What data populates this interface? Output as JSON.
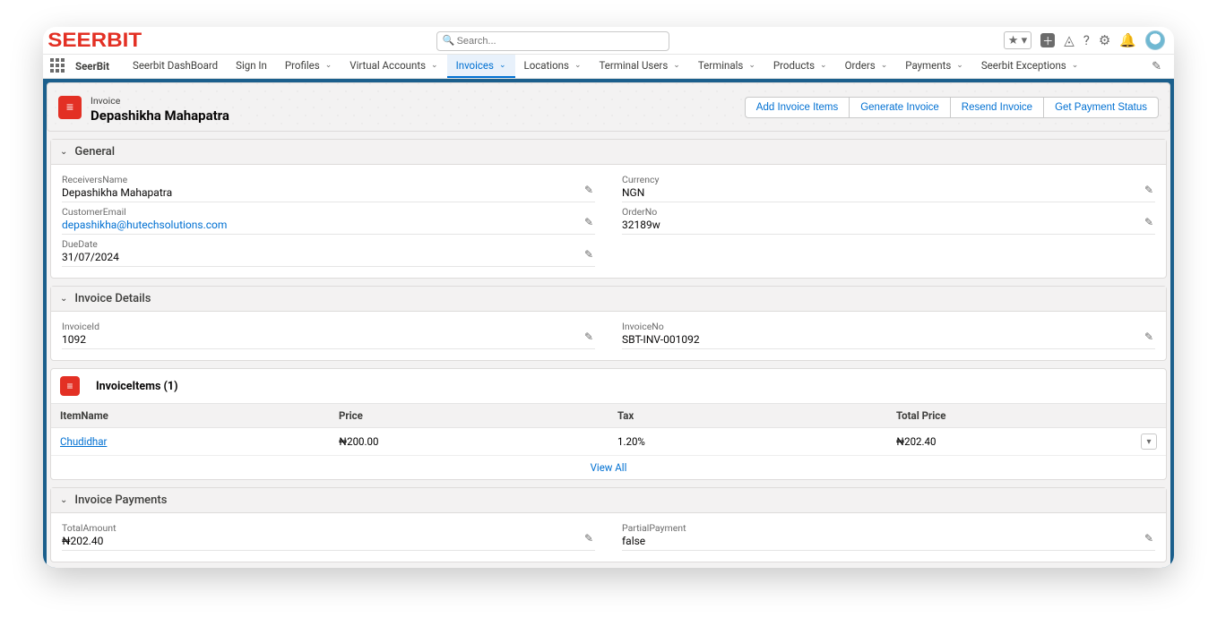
{
  "brand": "SEERBIT",
  "search": {
    "placeholder": "Search..."
  },
  "appName": "SeerBit",
  "nav": [
    {
      "label": "Seerbit DashBoard",
      "hasMenu": false,
      "active": false
    },
    {
      "label": "Sign In",
      "hasMenu": false,
      "active": false
    },
    {
      "label": "Profiles",
      "hasMenu": true,
      "active": false
    },
    {
      "label": "Virtual Accounts",
      "hasMenu": true,
      "active": false
    },
    {
      "label": "Invoices",
      "hasMenu": true,
      "active": true
    },
    {
      "label": "Locations",
      "hasMenu": true,
      "active": false
    },
    {
      "label": "Terminal Users",
      "hasMenu": true,
      "active": false
    },
    {
      "label": "Terminals",
      "hasMenu": true,
      "active": false
    },
    {
      "label": "Products",
      "hasMenu": true,
      "active": false
    },
    {
      "label": "Orders",
      "hasMenu": true,
      "active": false
    },
    {
      "label": "Payments",
      "hasMenu": true,
      "active": false
    },
    {
      "label": "Seerbit Exceptions",
      "hasMenu": true,
      "active": false
    }
  ],
  "highlights": {
    "object": "Invoice",
    "title": "Depashikha Mahapatra",
    "actions": [
      "Add Invoice Items",
      "Generate Invoice",
      "Resend Invoice",
      "Get Payment Status"
    ]
  },
  "sections": {
    "general": {
      "title": "General",
      "left": [
        {
          "label": "ReceiversName",
          "value": "Depashikha Mahapatra",
          "editable": true
        },
        {
          "label": "CustomerEmail",
          "value": "depashikha@hutechsolutions.com",
          "editable": true,
          "link": true
        },
        {
          "label": "DueDate",
          "value": "31/07/2024",
          "editable": true
        }
      ],
      "right": [
        {
          "label": "Currency",
          "value": "NGN",
          "editable": true
        },
        {
          "label": "OrderNo",
          "value": "32189w",
          "editable": true
        }
      ]
    },
    "invoiceDetails": {
      "title": "Invoice Details",
      "left": [
        {
          "label": "InvoiceId",
          "value": "1092",
          "editable": true
        }
      ],
      "right": [
        {
          "label": "InvoiceNo",
          "value": "SBT-INV-001092",
          "editable": true
        }
      ]
    },
    "invoicePayments": {
      "title": "Invoice Payments",
      "left": [
        {
          "label": "TotalAmount",
          "value": "₦202.40",
          "editable": true
        }
      ],
      "right": [
        {
          "label": "PartialPayment",
          "value": "false",
          "editable": true
        }
      ]
    }
  },
  "relatedList": {
    "title": "InvoiceItems",
    "count": "1",
    "columns": [
      "ItemName",
      "Price",
      "Tax",
      "Total Price"
    ],
    "rows": [
      {
        "ItemName": "Chudidhar",
        "Price": "₦200.00",
        "Tax": "1.20%",
        "Total Price": "₦202.40"
      }
    ],
    "viewAll": "View All"
  }
}
